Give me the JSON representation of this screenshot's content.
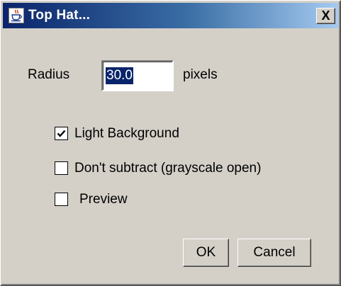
{
  "window": {
    "title": "Top Hat...",
    "close_glyph": "X"
  },
  "icons": {
    "title_icon": "java-cup-icon",
    "close_icon": "close-icon",
    "check_icon": "checkmark-icon"
  },
  "colors": {
    "titlebar_start": "#0a246a",
    "titlebar_end": "#a6caf0",
    "dialog_bg": "#d4d0c8",
    "selection_bg": "#0a246a"
  },
  "radius": {
    "label": "Radius",
    "value": "30.0",
    "unit": "pixels"
  },
  "options": [
    {
      "label": "Light Background",
      "checked": true
    },
    {
      "label": "Don't subtract (grayscale open)",
      "checked": false
    },
    {
      "label": "Preview",
      "checked": false
    }
  ],
  "buttons": {
    "ok": "OK",
    "cancel": "Cancel"
  }
}
